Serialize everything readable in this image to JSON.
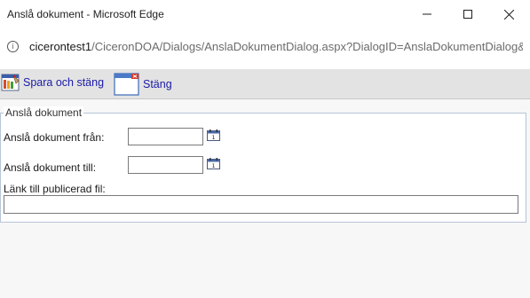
{
  "window": {
    "title": "Anslå dokument - Microsoft Edge",
    "minimize_glyph": "—",
    "maximize_glyph": "☐",
    "close_glyph": "✕"
  },
  "address": {
    "host": "cicerontest1",
    "path": "/CiceronDOA/Dialogs/AnslaDokumentDialog.aspx?DialogID=AnslaDokumentDialog&",
    "icon": "info-icon"
  },
  "toolbar": {
    "save_close_label": "Spara och stäng",
    "close_label": "Stäng"
  },
  "form": {
    "legend": "Anslå dokument",
    "from_label": "Anslå dokument från:",
    "from_value": "",
    "to_label": "Anslå dokument till:",
    "to_value": "",
    "link_label": "Länk till publicerad fil:",
    "link_value": ""
  },
  "colors": {
    "toolbar_bg": "#e3e3e3",
    "link_text": "#1a1aa8",
    "fieldset_border": "#b8c4d8"
  }
}
